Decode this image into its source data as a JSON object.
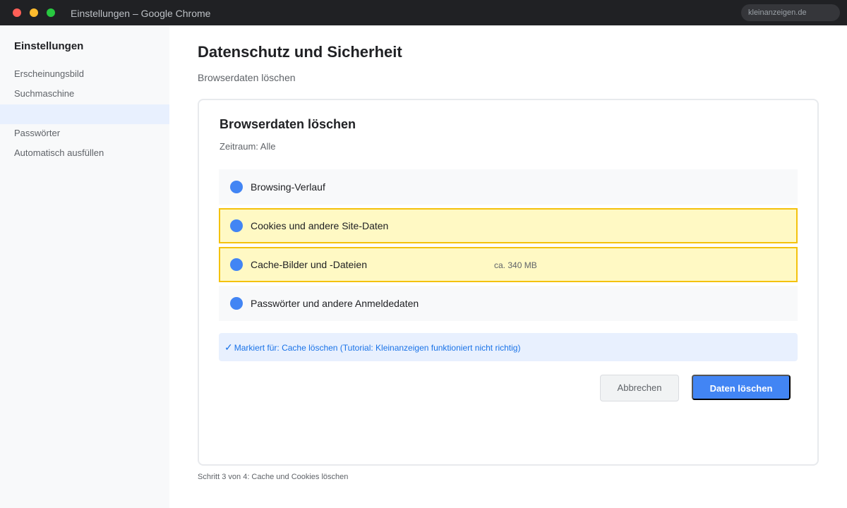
{
  "window": {
    "title": "Einstellungen – Google Chrome",
    "omnibox": "kleinanzeigen.de"
  },
  "sidebar": {
    "title": "Einstellungen",
    "items": [
      {
        "label": "Erscheinungsbild"
      },
      {
        "label": "Suchmaschine"
      },
      {
        "label": ""
      },
      {
        "label": "Passwörter"
      },
      {
        "label": "Automatisch ausfüllen"
      }
    ]
  },
  "main": {
    "title": "Datenschutz und Sicherheit",
    "subtitle": "Browserdaten löschen"
  },
  "dialog": {
    "title": "Browserdaten löschen",
    "range": "Zeitraum: Alle",
    "options": [
      {
        "label": "Browsing-Verlauf",
        "size": "",
        "highlighted": false
      },
      {
        "label": "Cookies und andere Site-Daten",
        "size": "",
        "highlighted": true
      },
      {
        "label": "Cache-Bilder und -Dateien",
        "size": "ca. 340 MB",
        "highlighted": true
      },
      {
        "label": "Passwörter und andere Anmeldedaten",
        "size": "",
        "highlighted": false
      }
    ],
    "banner": "Markiert für: Cache löschen (Tutorial: Kleinanzeigen funktioniert nicht richtig)",
    "cancel_label": "Abbrechen",
    "delete_label": "Daten löschen"
  },
  "footer": {
    "step": "Schritt 3 von 4: Cache und Cookies löschen"
  },
  "colors": {
    "accent": "#4285f4",
    "highlight_fill": "#fff9c4",
    "highlight_border": "#f4c20d",
    "banner_text": "#1a73e8"
  }
}
